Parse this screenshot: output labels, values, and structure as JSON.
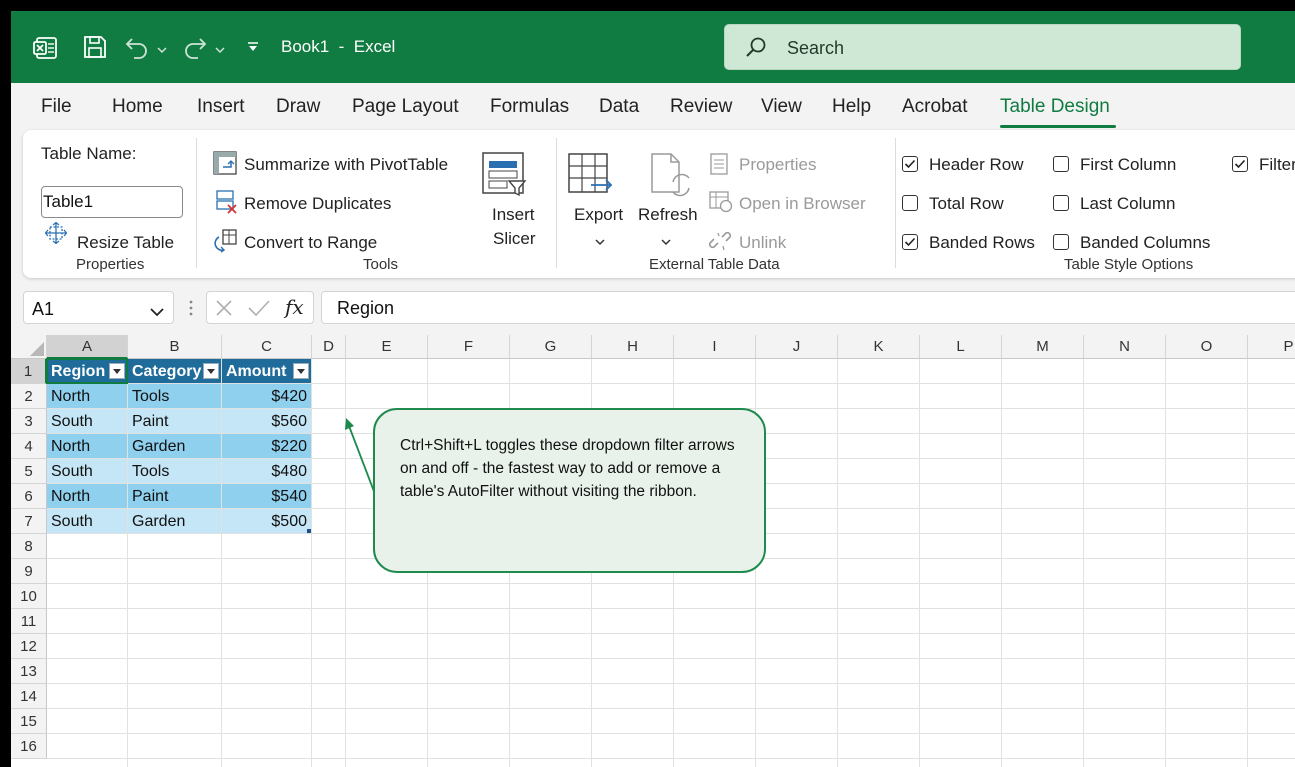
{
  "titlebar": {
    "doc_title": "Book1  -  Excel",
    "search_placeholder": "Search"
  },
  "menu": [
    {
      "label": "File"
    },
    {
      "label": "Home"
    },
    {
      "label": "Insert"
    },
    {
      "label": "Draw"
    },
    {
      "label": "Page Layout"
    },
    {
      "label": "Formulas"
    },
    {
      "label": "Data"
    },
    {
      "label": "Review"
    },
    {
      "label": "View"
    },
    {
      "label": "Help"
    },
    {
      "label": "Acrobat"
    },
    {
      "label": "Table Design",
      "active": true
    }
  ],
  "ribbon": {
    "properties": {
      "table_name_label": "Table Name:",
      "table_name_value": "Table1",
      "resize_label": "Resize Table",
      "group_label": "Properties"
    },
    "tools": {
      "summarize": "Summarize with PivotTable",
      "remove_dup": "Remove Duplicates",
      "convert": "Convert to Range",
      "insert_slicer_1": "Insert",
      "insert_slicer_2": "Slicer",
      "group_label": "Tools"
    },
    "external": {
      "export": "Export",
      "refresh": "Refresh",
      "properties": "Properties",
      "open_browser": "Open in Browser",
      "unlink": "Unlink",
      "group_label": "External Table Data"
    },
    "style_options": {
      "header_row": {
        "label": "Header Row",
        "checked": true
      },
      "total_row": {
        "label": "Total Row",
        "checked": false
      },
      "banded_rows": {
        "label": "Banded Rows",
        "checked": true
      },
      "first_column": {
        "label": "First Column",
        "checked": false
      },
      "last_column": {
        "label": "Last Column",
        "checked": false
      },
      "banded_columns": {
        "label": "Banded Columns",
        "checked": false
      },
      "filter": {
        "label": "Filter",
        "checked": true
      },
      "group_label": "Table Style Options"
    }
  },
  "formula_bar": {
    "name_box": "A1",
    "formula": "Region"
  },
  "grid": {
    "columns": [
      "A",
      "B",
      "C",
      "D",
      "E",
      "F",
      "G",
      "H",
      "I",
      "J",
      "K",
      "L",
      "M",
      "N",
      "O",
      "P"
    ],
    "rows": [
      "1",
      "2",
      "3",
      "4",
      "5",
      "6",
      "7",
      "8",
      "9",
      "10",
      "11",
      "12",
      "13",
      "14",
      "15",
      "16"
    ]
  },
  "table": {
    "headers": [
      "Region",
      "Category",
      "Amount"
    ],
    "rows": [
      [
        "North",
        "Tools",
        "$420"
      ],
      [
        "South",
        "Paint",
        "$560"
      ],
      [
        "North",
        "Garden",
        "$220"
      ],
      [
        "South",
        "Tools",
        "$480"
      ],
      [
        "North",
        "Paint",
        "$540"
      ],
      [
        "South",
        "Garden",
        "$500"
      ]
    ],
    "colors": {
      "header": "#1f6b9a",
      "band1": "#8fd0ee",
      "band2": "#c5e6f6"
    }
  },
  "callout": {
    "text": "Ctrl+Shift+L toggles these dropdown filter arrows on and off - the fastest way to add or remove a table's AutoFilter without visiting the ribbon."
  },
  "colors": {
    "accent": "#107c41"
  }
}
